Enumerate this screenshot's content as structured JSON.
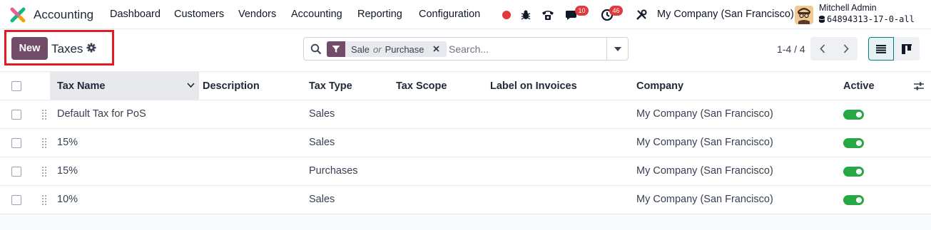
{
  "navbar": {
    "app_name": "Accounting",
    "menu": [
      "Dashboard",
      "Customers",
      "Vendors",
      "Accounting",
      "Reporting",
      "Configuration"
    ],
    "messages_count": "10",
    "activities_count": "46",
    "company": "My Company (San Francisco)",
    "user_name": "Mitchell Admin",
    "db_name": "64894313-17-0-all",
    "status_color": "#e0393e"
  },
  "control": {
    "new_label": "New",
    "title": "Taxes",
    "search": {
      "facet_value_1": "Sale",
      "facet_or": "or",
      "facet_value_2": "Purchase",
      "placeholder": "Search..."
    },
    "pager": "1-4 / 4"
  },
  "table": {
    "columns": [
      "Tax Name",
      "Description",
      "Tax Type",
      "Tax Scope",
      "Label on Invoices",
      "Company",
      "Active"
    ],
    "rows": [
      {
        "name": "Default Tax for PoS",
        "description": "",
        "type": "Sales",
        "scope": "",
        "label": "",
        "company": "My Company (San Francisco)",
        "active": true
      },
      {
        "name": "15%",
        "description": "",
        "type": "Sales",
        "scope": "",
        "label": "",
        "company": "My Company (San Francisco)",
        "active": true
      },
      {
        "name": "15%",
        "description": "",
        "type": "Purchases",
        "scope": "",
        "label": "",
        "company": "My Company (San Francisco)",
        "active": true
      },
      {
        "name": "10%",
        "description": "",
        "type": "Sales",
        "scope": "",
        "label": "",
        "company": "My Company (San Francisco)",
        "active": true
      }
    ]
  },
  "colors": {
    "brand": "#714b67",
    "accent": "#017e84",
    "toggle_on": "#28a745",
    "highlight": "#e01b24"
  }
}
